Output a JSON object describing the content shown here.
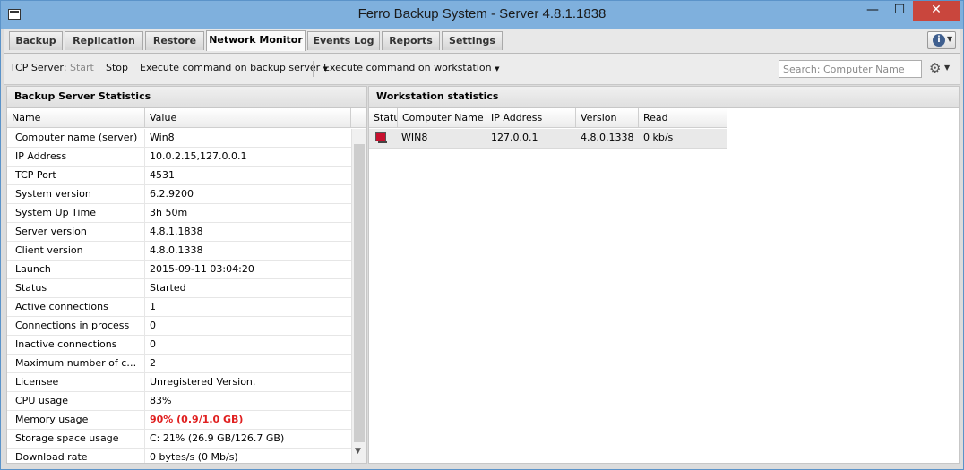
{
  "window": {
    "title": "Ferro Backup System - Server 4.8.1.1838"
  },
  "tabs": [
    {
      "label": "Backup"
    },
    {
      "label": "Replication"
    },
    {
      "label": "Restore"
    },
    {
      "label": "Network Monitor",
      "active": true
    },
    {
      "label": "Events Log"
    },
    {
      "label": "Reports"
    },
    {
      "label": "Settings"
    }
  ],
  "toolbar": {
    "tcp_label": "TCP Server:",
    "start": "Start",
    "stop": "Stop",
    "exec_server": "Execute command on backup server",
    "exec_workstation": "Execute command on workstation",
    "search_placeholder": "Search: Computer Name"
  },
  "left_panel": {
    "title": "Backup Server Statistics",
    "columns": [
      "Name",
      "Value"
    ],
    "rows": [
      {
        "name": "Computer name (server)",
        "value": "Win8"
      },
      {
        "name": "IP Address",
        "value": "10.0.2.15,127.0.0.1"
      },
      {
        "name": "TCP Port",
        "value": "4531"
      },
      {
        "name": "System version",
        "value": "6.2.9200"
      },
      {
        "name": "System Up Time",
        "value": "3h 50m"
      },
      {
        "name": "Server version",
        "value": "4.8.1.1838"
      },
      {
        "name": "Client version",
        "value": "4.8.0.1338"
      },
      {
        "name": "Launch",
        "value": "2015-09-11 03:04:20"
      },
      {
        "name": "Status",
        "value": "Started"
      },
      {
        "name": "Active connections",
        "value": "1"
      },
      {
        "name": "Connections in process",
        "value": "0"
      },
      {
        "name": "Inactive connections",
        "value": "0"
      },
      {
        "name": "Maximum number of conne...",
        "value": "2"
      },
      {
        "name": "Licensee",
        "value": "Unregistered Version."
      },
      {
        "name": "CPU usage",
        "value": "83%"
      },
      {
        "name": "Memory usage",
        "value": "90% (0.9/1.0 GB)",
        "alert": true
      },
      {
        "name": "Storage space usage",
        "value": "C: 21% (26.9 GB/126.7 GB)"
      },
      {
        "name": "Download rate",
        "value": "0 bytes/s (0 Mb/s)"
      }
    ]
  },
  "right_panel": {
    "title": "Workstation statistics",
    "columns": [
      "Status",
      "Computer Name",
      "IP Address",
      "Version",
      "Read"
    ],
    "rows": [
      {
        "computer": "WIN8",
        "ip": "127.0.0.1",
        "version": "4.8.0.1338",
        "read": "0 kb/s"
      }
    ]
  },
  "colors": {
    "alert": "#e02020",
    "titlebar": "#7fb0dd",
    "close": "#c9463d"
  }
}
